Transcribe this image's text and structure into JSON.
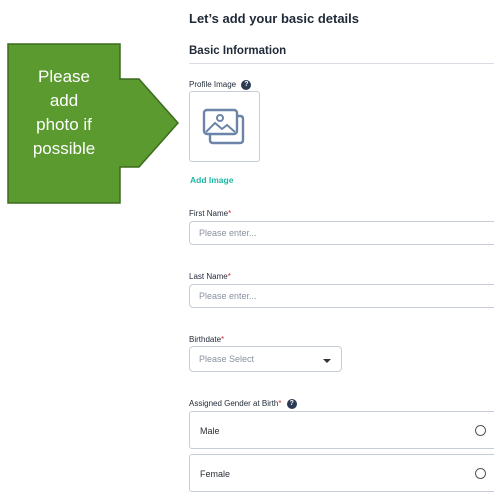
{
  "callout": {
    "lines": [
      "Please",
      "add",
      "photo if",
      "possible"
    ],
    "fill_color": "#5a9a2e",
    "border_color": "#3d6b1e"
  },
  "form": {
    "page_title": "Let’s add your basic details",
    "section_title": "Basic Information",
    "profile_image": {
      "label": "Profile Image",
      "help_icon": "question-circle-icon",
      "image_icon": "image-gallery-icon",
      "add_link": "Add Image"
    },
    "first_name": {
      "label": "First Name",
      "required_mark": "*",
      "placeholder": "Please enter..."
    },
    "last_name": {
      "label": "Last Name",
      "required_mark": "*",
      "placeholder": "Please enter..."
    },
    "birthdate": {
      "label": "Birthdate",
      "required_mark": "*",
      "placeholder": "Please Select"
    },
    "gender": {
      "label": "Assigned Gender at Birth",
      "required_mark": "*",
      "help_icon": "question-circle-icon",
      "options": [
        {
          "label": "Male"
        },
        {
          "label": "Female"
        }
      ]
    }
  },
  "colors": {
    "accent_link": "#1fb8a6",
    "required": "#d32f2f",
    "border": "#c7cdd6"
  }
}
